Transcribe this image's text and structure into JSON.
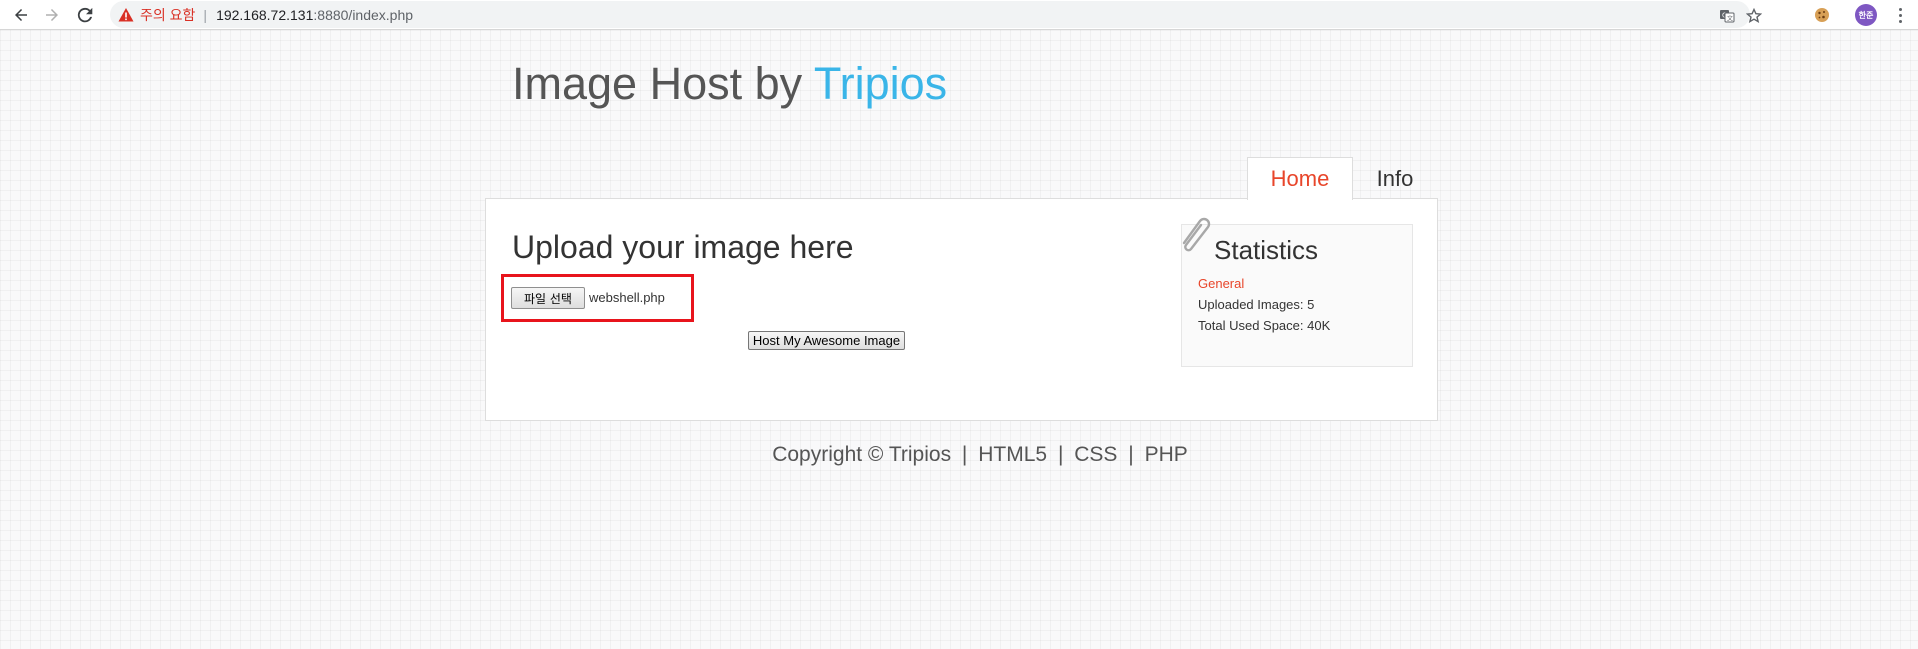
{
  "browser": {
    "security_label": "주의 요함",
    "separator": "|",
    "url_host": "192.168.72.131",
    "url_rest": ":8880/index.php",
    "profile_initials": "한준",
    "icons": [
      "back-arrow-icon",
      "forward-arrow-icon",
      "reload-icon",
      "warning-icon",
      "translate-icon",
      "star-icon",
      "cookie-icon",
      "menu-dots-icon"
    ]
  },
  "header": {
    "title_prefix": "Image Host by ",
    "title_brand": "Tripios",
    "brand_color": "#3ab5e8"
  },
  "tabs": [
    {
      "label": "Home",
      "active": true
    },
    {
      "label": "Info",
      "active": false
    }
  ],
  "upload": {
    "heading": "Upload your image here",
    "file_button_label": "파일 선택",
    "selected_file": "webshell.php",
    "submit_label": "Host My Awesome Image"
  },
  "stats": {
    "heading": "Statistics",
    "section": "General",
    "uploaded_images": "Uploaded Images: 5",
    "total_space": "Total Used Space: 40K"
  },
  "footer": {
    "copyright": "Copyright © Tripios",
    "links": [
      "HTML5",
      "CSS",
      "PHP"
    ],
    "separator": "|"
  },
  "colors": {
    "accent": "#e8462b",
    "highlight": "#e8141c"
  }
}
